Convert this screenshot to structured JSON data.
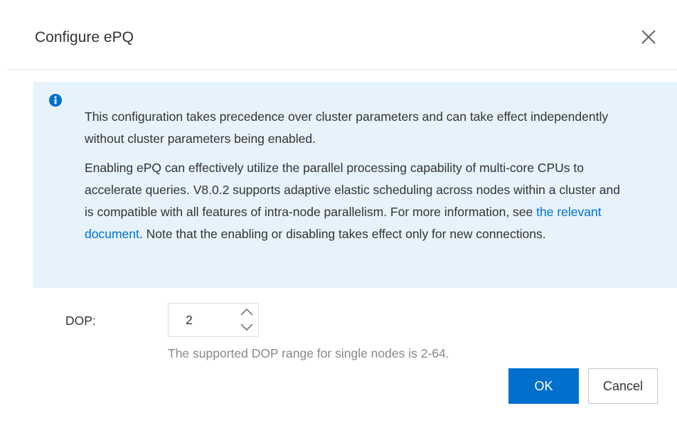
{
  "dialog": {
    "title": "Configure ePQ"
  },
  "info": {
    "paragraph1": "This configuration takes precedence over cluster parameters and can take effect independently without cluster parameters being enabled.",
    "paragraph2_before_link": "Enabling ePQ can effectively utilize the parallel processing capability of multi-core CPUs to accelerate queries. V8.0.2 supports adaptive elastic scheduling across nodes within a cluster and is compatible with all features of intra-node parallelism. For more information, see ",
    "link_text": "the relevant document",
    "paragraph2_after_link": ". Note that the enabling or disabling takes effect only for new connections."
  },
  "form": {
    "dop_label": "DOP:",
    "dop_value": "2",
    "hint": "The supported DOP range for single nodes is 2-64."
  },
  "footer": {
    "ok_label": "OK",
    "cancel_label": "Cancel"
  },
  "colors": {
    "primary": "#0070cc",
    "info_background": "#e6f3fc",
    "info_icon": "#0070cc"
  },
  "icons": {
    "close": "close-icon",
    "info": "info-icon",
    "up": "chevron-up-icon",
    "down": "chevron-down-icon"
  }
}
